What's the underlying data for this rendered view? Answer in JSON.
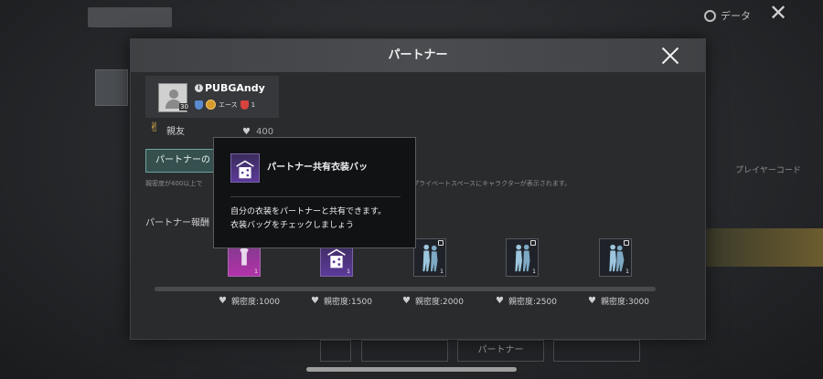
{
  "background": {
    "tabs": [
      "",
      ""
    ],
    "data_label": "データ",
    "close_label": "✕",
    "menu_items": [
      "",
      "",
      "",
      "プレイヤーコード",
      "",
      "",
      ""
    ],
    "bottom_buttons": [
      "",
      "",
      "パートナー",
      ""
    ]
  },
  "dialog": {
    "title": "パートナー",
    "profile": {
      "name": "PUBGAndy",
      "level": "30",
      "rank_label": "エース",
      "rank_number": "1"
    },
    "relation": {
      "label": "親友",
      "heart_value": "400"
    },
    "partner_button": "パートナーの",
    "note_start": "親密度が400以上で",
    "note_end": "プライベートスペースにキャラクターが表示されます。",
    "rewards_title": "パートナー報酬",
    "rewards": [
      {
        "label": "親密度:1000",
        "count": "1",
        "locked": false,
        "icon": "outfit-icon"
      },
      {
        "label": "親密度:1500",
        "count": "1",
        "locked": false,
        "icon": "shared-bag-icon"
      },
      {
        "label": "親密度:2000",
        "count": "1",
        "locked": true,
        "icon": "pose-icon"
      },
      {
        "label": "親密度:2500",
        "count": "1",
        "locked": true,
        "icon": "pose-icon"
      },
      {
        "label": "親密度:3000",
        "count": "1",
        "locked": true,
        "icon": "pose-icon"
      }
    ]
  },
  "tooltip": {
    "title": "パートナー共有衣装バッ",
    "description_line1": "自分の衣装をパートナーと共有できます。",
    "description_line2": "衣装バッグをチェックしましょう"
  },
  "colors": {
    "accent_teal": "#6aa3a0",
    "reward_purple": "#b232a8",
    "menu_highlight": "#e7c46b"
  }
}
